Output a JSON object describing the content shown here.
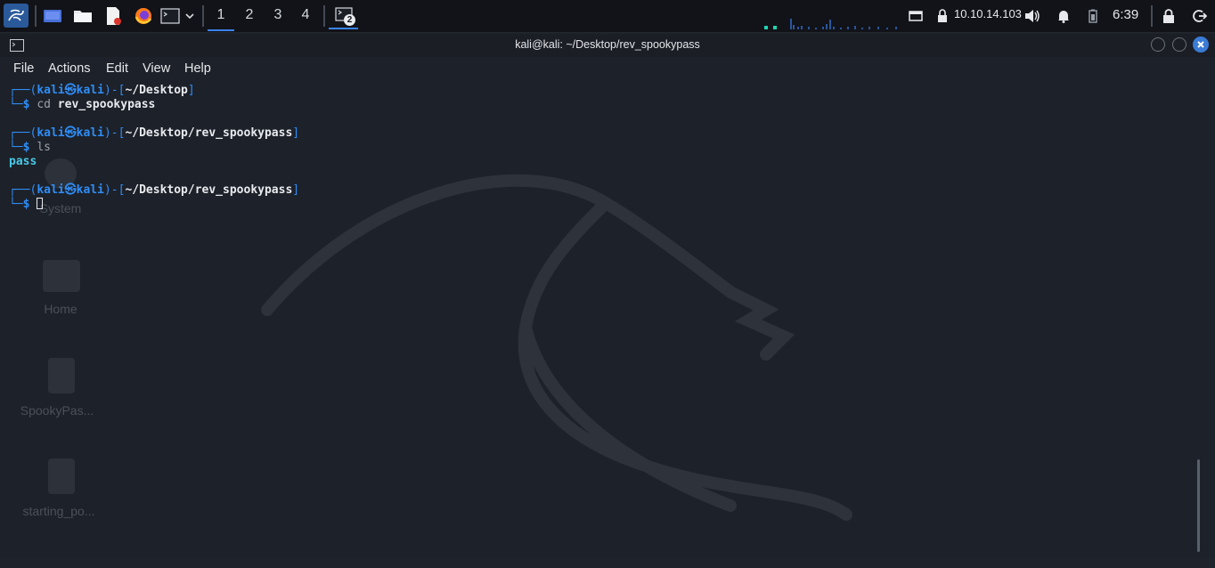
{
  "panel": {
    "workspaces": [
      "1",
      "2",
      "3",
      "4"
    ],
    "active_workspace": "1",
    "terminal_badge": "2",
    "ip_address": "10.10.14.103",
    "clock": "6:39"
  },
  "window": {
    "title": "kali@kali: ~/Desktop/rev_spookypass"
  },
  "menubar": {
    "items": [
      "File",
      "Actions",
      "Edit",
      "View",
      "Help"
    ]
  },
  "terminal": {
    "prompt_user": "kali",
    "prompt_at": "㉿",
    "prompt_host": "kali",
    "blocks": [
      {
        "path": "~/Desktop",
        "command": "cd",
        "argument": "rev_spookypass",
        "output": ""
      },
      {
        "path": "~/Desktop/rev_spookypass",
        "command": "ls",
        "argument": "",
        "output": "pass"
      },
      {
        "path": "~/Desktop/rev_spookypass",
        "command": "",
        "argument": "",
        "output": ""
      }
    ]
  },
  "desktop_icons": [
    "System",
    "Home",
    "SpookyPas...",
    "starting_po..."
  ],
  "colors": {
    "panel_bg": "#111318",
    "terminal_bg": "#1d2129",
    "prompt_blue": "#2f8df5",
    "accent": "#3b82f6",
    "close_button": "#3a7bd5"
  }
}
